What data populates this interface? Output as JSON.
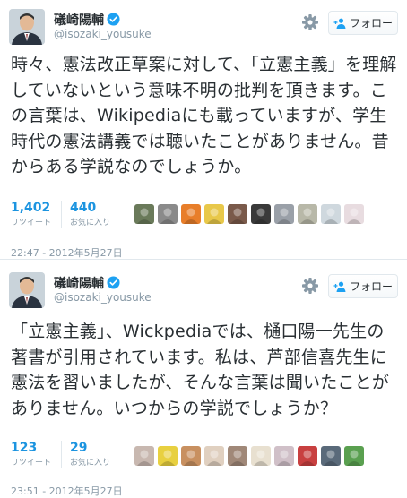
{
  "tweets": [
    {
      "display_name": "礒崎陽輔",
      "handle": "@isozaki_yousuke",
      "follow_label": "フォロー",
      "text": "時々、憲法改正草案に対して、「立憲主義」を理解していないという意味不明の批判を頂きます。この言葉は、Wikipediaにも載っていますが、学生時代の憲法講義では聴いたことがありません。昔からある学説なのでしょうか。",
      "retweets": "1,402",
      "retweets_label": "リツイート",
      "favorites": "440",
      "favorites_label": "お気に入り",
      "timestamp": "22:47 - 2012年5月27日",
      "favoriter_avatars": [
        "#6a7a5a",
        "#8a8a8a",
        "#e87e2a",
        "#e8c84a",
        "#7a5a4a",
        "#3a3a3a",
        "#9aa0a8",
        "#b8b8a8",
        "#cfd8de",
        "#e8dce0"
      ]
    },
    {
      "display_name": "礒崎陽輔",
      "handle": "@isozaki_yousuke",
      "follow_label": "フォロー",
      "text": "「立憲主義」、Wickpediaでは、樋口陽一先生の著書が引用されています。私は、芦部信喜先生に憲法を習いましたが、そんな言葉は聞いたことがありません。いつからの学説でしょうか？",
      "retweets": "123",
      "retweets_label": "リツイート",
      "favorites": "29",
      "favorites_label": "お気に入り",
      "timestamp": "23:51 - 2012年5月27日",
      "favoriter_avatars": [
        "#c8b8b0",
        "#e8d040",
        "#c89060",
        "#e0d0c0",
        "#a08878",
        "#e8e0d0",
        "#d0c0c8",
        "#c84040",
        "#5a6a7a",
        "#5aa050"
      ]
    }
  ],
  "colors": {
    "link": "#1c94e0",
    "muted": "#8899a6",
    "text": "#292f33",
    "verified": "#1da1f2"
  },
  "icons": {
    "gear": "gear-icon",
    "verified": "verified-badge-icon",
    "follow": "add-user-icon"
  }
}
